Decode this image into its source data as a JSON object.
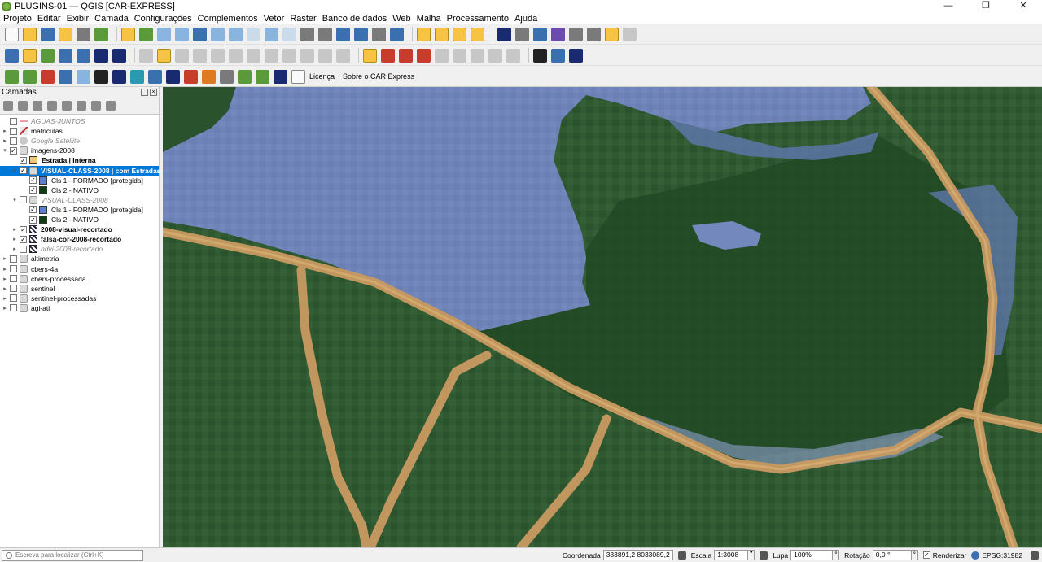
{
  "window": {
    "title": "PLUGINS-01 — QGIS [CAR-EXPRESS]",
    "controls": [
      "—",
      "❐",
      "✕"
    ]
  },
  "menu": [
    "Projeto",
    "Editar",
    "Exibir",
    "Camada",
    "Configurações",
    "Complementos",
    "Vetor",
    "Raster",
    "Banco de dados",
    "Web",
    "Malha",
    "Processamento",
    "Ajuda"
  ],
  "plugin_toolbar": {
    "license_label": "Licença",
    "about_label": "Sobre o CAR Express"
  },
  "layers_panel": {
    "title": "Camadas",
    "layers": [
      {
        "label": "AGUAS-JUNTOS",
        "checked": false,
        "style": "ital",
        "icon": "line-icon",
        "expand": "",
        "indent": 0
      },
      {
        "label": "matriculas",
        "checked": false,
        "style": "",
        "icon": "vector-layer-icon",
        "expand": "▸",
        "indent": 0
      },
      {
        "label": "Google Satellite",
        "checked": false,
        "style": "ital",
        "icon": "web-layer-icon",
        "expand": "▸",
        "indent": 0
      },
      {
        "label": "imagens-2008",
        "checked": true,
        "style": "",
        "icon": "group-icon",
        "expand": "▾",
        "indent": 0
      },
      {
        "label": "Estrada | Interna",
        "checked": true,
        "style": "bold",
        "icon": "swatch",
        "swatch": "#f3c47a",
        "expand": "",
        "indent": 1
      },
      {
        "label": "VISUAL-CLASS-2008 | com Estradas",
        "checked": true,
        "style": "bold",
        "icon": "group-icon",
        "expand": "▾",
        "indent": 1,
        "selected": true
      },
      {
        "label": "Cls 1 - FORMADO [protegida]",
        "checked": true,
        "style": "",
        "icon": "swatch",
        "swatch": "#5b7fd6",
        "expand": "",
        "indent": 2
      },
      {
        "label": "Cls 2 - NATIVO",
        "checked": true,
        "style": "",
        "icon": "swatch",
        "swatch": "#0d3d12",
        "expand": "",
        "indent": 2
      },
      {
        "label": "VISUAL-CLASS-2008",
        "checked": false,
        "style": "ital",
        "icon": "group-icon",
        "expand": "▾",
        "indent": 1
      },
      {
        "label": "Cls 1 - FORMADO [protegida]",
        "checked": true,
        "style": "",
        "icon": "swatch",
        "swatch": "#5b7fd6",
        "expand": "",
        "indent": 2
      },
      {
        "label": "Cls 2 - NATIVO",
        "checked": true,
        "style": "",
        "icon": "swatch",
        "swatch": "#0d3d12",
        "expand": "",
        "indent": 2
      },
      {
        "label": "2008-visual-recortado",
        "checked": true,
        "style": "bold",
        "icon": "raster-icon",
        "expand": "▸",
        "indent": 1
      },
      {
        "label": "falsa-cor-2008-recortado",
        "checked": true,
        "style": "bold",
        "icon": "raster-icon",
        "expand": "▸",
        "indent": 1
      },
      {
        "label": "ndvi-2008-recortado",
        "checked": false,
        "style": "ital",
        "icon": "raster-icon",
        "expand": "▸",
        "indent": 1
      },
      {
        "label": "altimetria",
        "checked": false,
        "style": "",
        "icon": "group-icon",
        "expand": "▸",
        "indent": 0
      },
      {
        "label": "cbers-4a",
        "checked": false,
        "style": "",
        "icon": "group-icon",
        "expand": "▸",
        "indent": 0
      },
      {
        "label": "cbers-processada",
        "checked": false,
        "style": "",
        "icon": "group-icon",
        "expand": "▸",
        "indent": 0
      },
      {
        "label": "sentinel",
        "checked": false,
        "style": "",
        "icon": "group-icon",
        "expand": "▸",
        "indent": 0
      },
      {
        "label": "sentinel-processadas",
        "checked": false,
        "style": "",
        "icon": "group-icon",
        "expand": "▸",
        "indent": 0
      },
      {
        "label": "agi-ati",
        "checked": false,
        "style": "",
        "icon": "group-icon",
        "expand": "▸",
        "indent": 0
      }
    ]
  },
  "statusbar": {
    "locator_placeholder": "Escreva para localizar (Ctrl+K)",
    "coordinate_label": "Coordenada",
    "coordinate_value": "333891,2  8033089,2",
    "scale_label": "Escala",
    "scale_value": "1:3008",
    "magnifier_label": "Lupa",
    "magnifier_value": "100%",
    "rotation_label": "Rotação",
    "rotation_value": "0,0 °",
    "render_label": "Renderizar",
    "crs_value": "EPSG:31982"
  },
  "colors": {
    "map_green": "#2f5a32",
    "water_blue": "#6f83b8",
    "road": "#c99a62",
    "selection": "#0078d7"
  }
}
